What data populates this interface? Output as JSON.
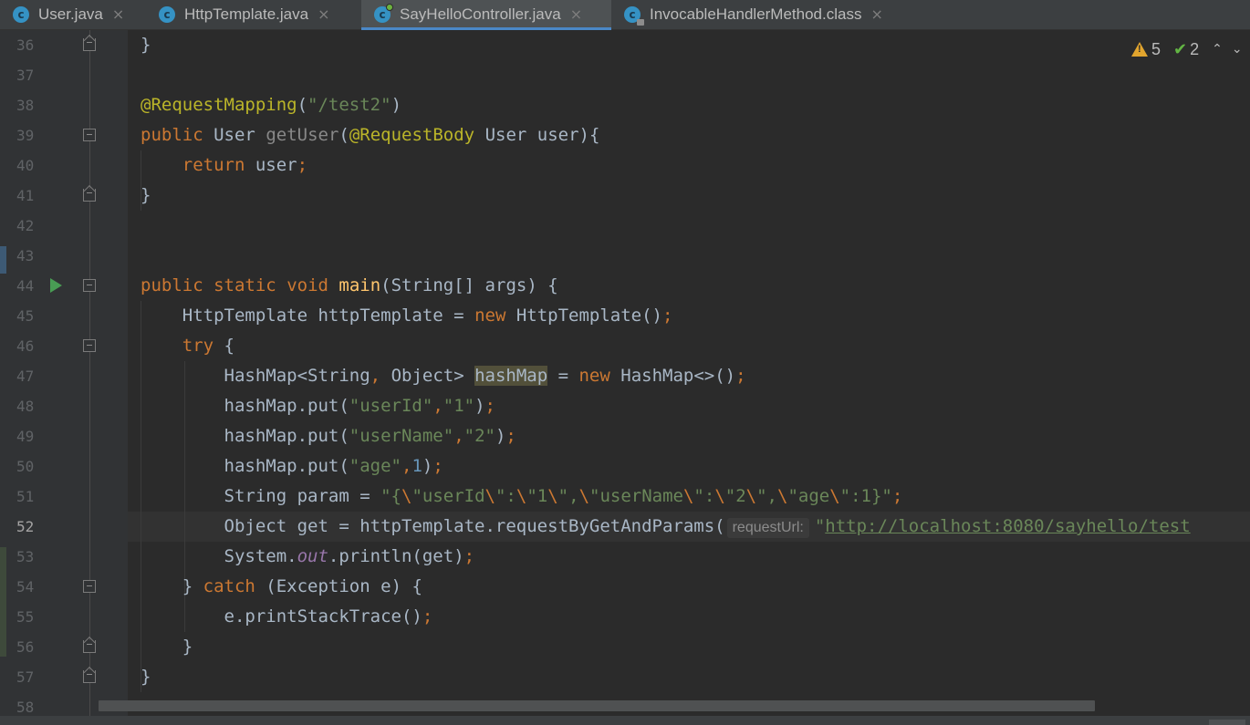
{
  "tabs": [
    {
      "label": "User.java",
      "icon": "class-icon",
      "active": false
    },
    {
      "label": "HttpTemplate.java",
      "icon": "class-icon",
      "active": false
    },
    {
      "label": "SayHelloController.java",
      "icon": "spring-class-icon",
      "active": true
    },
    {
      "label": "InvocableHandlerMethod.class",
      "icon": "locked-class-icon",
      "active": false
    }
  ],
  "tab_close_glyph": "×",
  "inspections": {
    "warnings": "5",
    "weak_warnings": "2"
  },
  "gutter": {
    "line_numbers": [
      "36",
      "37",
      "38",
      "39",
      "40",
      "41",
      "42",
      "43",
      "44",
      "45",
      "46",
      "47",
      "48",
      "49",
      "50",
      "51",
      "52",
      "53",
      "54",
      "55",
      "56",
      "57",
      "58"
    ],
    "current_line": "52"
  },
  "code": {
    "l36": "}",
    "l38_ann": "@RequestMapping",
    "l38_str": "\"/test2\"",
    "l39_public": "public",
    "l39_type": "User",
    "l39_method": "getUser",
    "l39_ann": "@RequestBody",
    "l39_rest": " User user){",
    "l40_kw": "return",
    "l40_rest": " user",
    "l41": "}",
    "l44_public": "public",
    "l44_static": "static",
    "l44_void": "void",
    "l44_main": "main",
    "l44_rest": "(String[] args) {",
    "l45_a": "HttpTemplate httpTemplate = ",
    "l45_new": "new",
    "l45_b": " HttpTemplate()",
    "l46_try": "try",
    "l46_rest": " {",
    "l47_a": "HashMap<String",
    "l47_b": " Object> ",
    "l47_var": "hashMap",
    "l47_c": " = ",
    "l47_new": "new",
    "l47_d": " HashMap<>()",
    "l48_a": "hashMap.put(",
    "l48_s1": "\"userId\"",
    "l48_s2": "\"1\"",
    "l48_b": ")",
    "l49_a": "hashMap.put(",
    "l49_s1": "\"userName\"",
    "l49_s2": "\"2\"",
    "l49_b": ")",
    "l50_a": "hashMap.put(",
    "l50_s1": "\"age\"",
    "l50_n": "1",
    "l50_b": ")",
    "l51_a": "String param = ",
    "l51_s1": "\"{",
    "l51_s2": "\"userId",
    "l51_s3": "\":",
    "l51_s4": "\"1",
    "l51_s5": "\",",
    "l51_s6": "\"userName",
    "l51_s7": "\":",
    "l51_s8": "\"2",
    "l51_s9": "\",",
    "l51_s10": "\"age",
    "l51_s11": "\":1}\"",
    "esc": "\\",
    "l52_a": "Object get = httpTemplate.requestByGetAndParams(",
    "l52_hint": "requestUrl:",
    "l52_q": "\"",
    "l52_url": "http://localhost:8080/sayhello/test",
    "l53_a": "System.",
    "l53_out": "out",
    "l53_b": ".println(get)",
    "l54_a": "} ",
    "l54_catch": "catch",
    "l54_b": " (Exception e) {",
    "l55_a": "e.printStackTrace()",
    "l56": "}",
    "l57": "}",
    "semi": ";",
    "comma": ","
  }
}
